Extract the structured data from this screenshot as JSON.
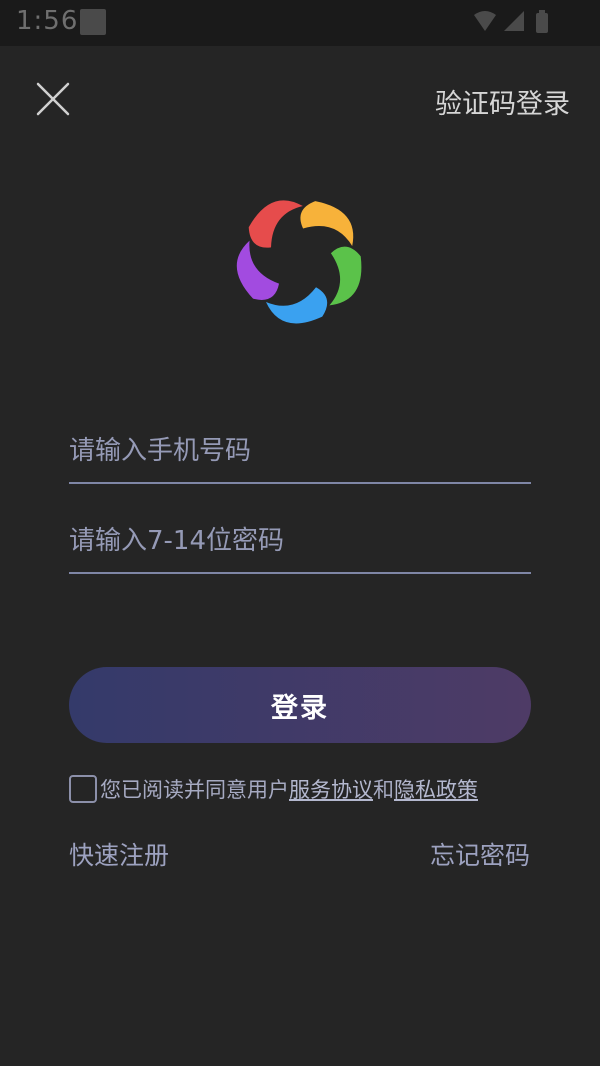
{
  "status_bar": {
    "time": "1:56"
  },
  "header": {
    "close_icon": "close-icon",
    "sms_login_label": "验证码登录"
  },
  "logo": {
    "icon": "pinwheel-logo-icon",
    "colors": [
      "#a24be0",
      "#e64c4c",
      "#f7b23a",
      "#5bc24a",
      "#3aa1f0"
    ]
  },
  "form": {
    "phone_placeholder": "请输入手机号码",
    "password_placeholder": "请输入7-14位密码",
    "login_label": "登录"
  },
  "agreement": {
    "prefix": "您已阅读并同意用户",
    "service_link": "服务协议",
    "conjunction": "和",
    "privacy_link": "隐私政策"
  },
  "footer": {
    "register_label": "快速注册",
    "forgot_label": "忘记密码"
  },
  "colors": {
    "background": "#252525",
    "accent_start": "#343a6a",
    "accent_end": "#4e3b66",
    "underline": "#7f86a6"
  }
}
